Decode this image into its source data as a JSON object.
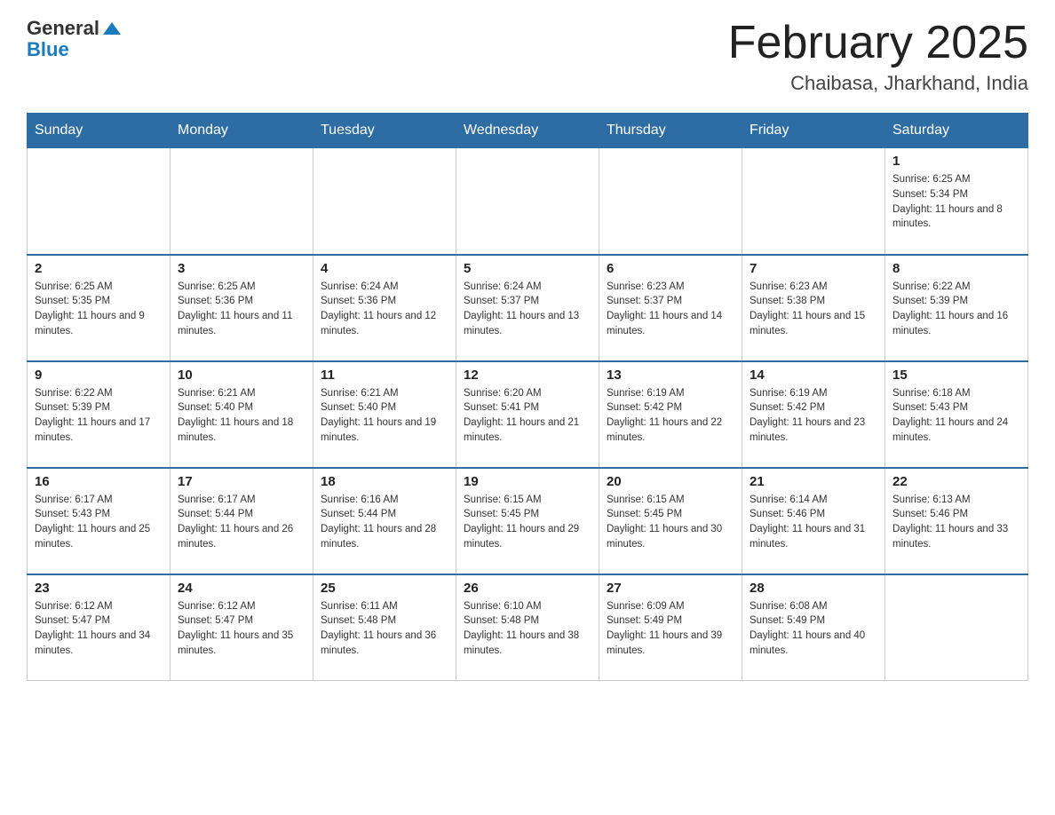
{
  "header": {
    "logo_general": "General",
    "logo_blue": "Blue",
    "month_title": "February 2025",
    "location": "Chaibasa, Jharkhand, India"
  },
  "days_of_week": [
    "Sunday",
    "Monday",
    "Tuesday",
    "Wednesday",
    "Thursday",
    "Friday",
    "Saturday"
  ],
  "weeks": [
    [
      {
        "day": "",
        "info": ""
      },
      {
        "day": "",
        "info": ""
      },
      {
        "day": "",
        "info": ""
      },
      {
        "day": "",
        "info": ""
      },
      {
        "day": "",
        "info": ""
      },
      {
        "day": "",
        "info": ""
      },
      {
        "day": "1",
        "info": "Sunrise: 6:25 AM\nSunset: 5:34 PM\nDaylight: 11 hours and 8 minutes."
      }
    ],
    [
      {
        "day": "2",
        "info": "Sunrise: 6:25 AM\nSunset: 5:35 PM\nDaylight: 11 hours and 9 minutes."
      },
      {
        "day": "3",
        "info": "Sunrise: 6:25 AM\nSunset: 5:36 PM\nDaylight: 11 hours and 11 minutes."
      },
      {
        "day": "4",
        "info": "Sunrise: 6:24 AM\nSunset: 5:36 PM\nDaylight: 11 hours and 12 minutes."
      },
      {
        "day": "5",
        "info": "Sunrise: 6:24 AM\nSunset: 5:37 PM\nDaylight: 11 hours and 13 minutes."
      },
      {
        "day": "6",
        "info": "Sunrise: 6:23 AM\nSunset: 5:37 PM\nDaylight: 11 hours and 14 minutes."
      },
      {
        "day": "7",
        "info": "Sunrise: 6:23 AM\nSunset: 5:38 PM\nDaylight: 11 hours and 15 minutes."
      },
      {
        "day": "8",
        "info": "Sunrise: 6:22 AM\nSunset: 5:39 PM\nDaylight: 11 hours and 16 minutes."
      }
    ],
    [
      {
        "day": "9",
        "info": "Sunrise: 6:22 AM\nSunset: 5:39 PM\nDaylight: 11 hours and 17 minutes."
      },
      {
        "day": "10",
        "info": "Sunrise: 6:21 AM\nSunset: 5:40 PM\nDaylight: 11 hours and 18 minutes."
      },
      {
        "day": "11",
        "info": "Sunrise: 6:21 AM\nSunset: 5:40 PM\nDaylight: 11 hours and 19 minutes."
      },
      {
        "day": "12",
        "info": "Sunrise: 6:20 AM\nSunset: 5:41 PM\nDaylight: 11 hours and 21 minutes."
      },
      {
        "day": "13",
        "info": "Sunrise: 6:19 AM\nSunset: 5:42 PM\nDaylight: 11 hours and 22 minutes."
      },
      {
        "day": "14",
        "info": "Sunrise: 6:19 AM\nSunset: 5:42 PM\nDaylight: 11 hours and 23 minutes."
      },
      {
        "day": "15",
        "info": "Sunrise: 6:18 AM\nSunset: 5:43 PM\nDaylight: 11 hours and 24 minutes."
      }
    ],
    [
      {
        "day": "16",
        "info": "Sunrise: 6:17 AM\nSunset: 5:43 PM\nDaylight: 11 hours and 25 minutes."
      },
      {
        "day": "17",
        "info": "Sunrise: 6:17 AM\nSunset: 5:44 PM\nDaylight: 11 hours and 26 minutes."
      },
      {
        "day": "18",
        "info": "Sunrise: 6:16 AM\nSunset: 5:44 PM\nDaylight: 11 hours and 28 minutes."
      },
      {
        "day": "19",
        "info": "Sunrise: 6:15 AM\nSunset: 5:45 PM\nDaylight: 11 hours and 29 minutes."
      },
      {
        "day": "20",
        "info": "Sunrise: 6:15 AM\nSunset: 5:45 PM\nDaylight: 11 hours and 30 minutes."
      },
      {
        "day": "21",
        "info": "Sunrise: 6:14 AM\nSunset: 5:46 PM\nDaylight: 11 hours and 31 minutes."
      },
      {
        "day": "22",
        "info": "Sunrise: 6:13 AM\nSunset: 5:46 PM\nDaylight: 11 hours and 33 minutes."
      }
    ],
    [
      {
        "day": "23",
        "info": "Sunrise: 6:12 AM\nSunset: 5:47 PM\nDaylight: 11 hours and 34 minutes."
      },
      {
        "day": "24",
        "info": "Sunrise: 6:12 AM\nSunset: 5:47 PM\nDaylight: 11 hours and 35 minutes."
      },
      {
        "day": "25",
        "info": "Sunrise: 6:11 AM\nSunset: 5:48 PM\nDaylight: 11 hours and 36 minutes."
      },
      {
        "day": "26",
        "info": "Sunrise: 6:10 AM\nSunset: 5:48 PM\nDaylight: 11 hours and 38 minutes."
      },
      {
        "day": "27",
        "info": "Sunrise: 6:09 AM\nSunset: 5:49 PM\nDaylight: 11 hours and 39 minutes."
      },
      {
        "day": "28",
        "info": "Sunrise: 6:08 AM\nSunset: 5:49 PM\nDaylight: 11 hours and 40 minutes."
      },
      {
        "day": "",
        "info": ""
      }
    ]
  ]
}
